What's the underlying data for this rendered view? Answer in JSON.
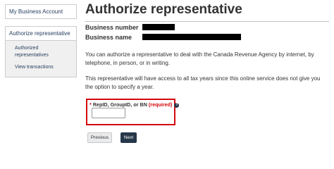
{
  "sidebar": {
    "top_item": "My Business Account",
    "active_item": "Authorize representative",
    "sub_items": [
      {
        "label": "Authorized representatives"
      },
      {
        "label": "View transactions"
      }
    ]
  },
  "main": {
    "title": "Authorize representative",
    "business_number_label": "Business number",
    "business_name_label": "Business name",
    "paragraph1": "You can authorize a representative to deal with the Canada Revenue Agency by internet, by telephone, in person, or in writing.",
    "paragraph2": "This representative will have access to all tax years since this online service does not give you the option to specify a year."
  },
  "form": {
    "required_star": "*",
    "field_label": "RepID, GroupID, or BN",
    "required_text": "(required)",
    "help_icon_glyph": "?",
    "input_value": ""
  },
  "buttons": {
    "previous": "Previous",
    "next": "Next"
  },
  "colors": {
    "highlight_red": "#d3080c",
    "nav_blue": "#284162",
    "button_dark": "#26374a"
  }
}
